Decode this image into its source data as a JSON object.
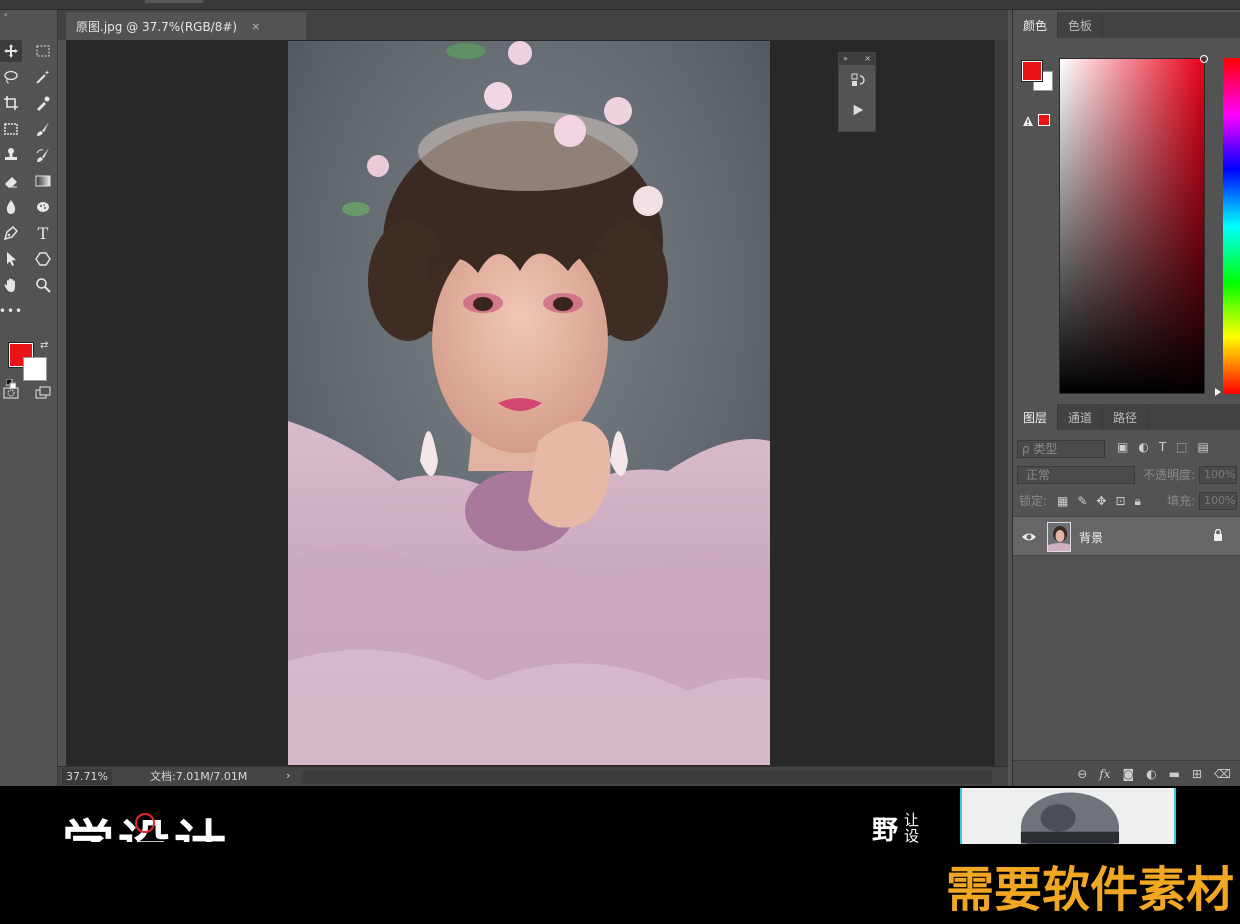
{
  "document": {
    "tab_title": "原图.jpg @ 37.7%(RGB/8#)",
    "tab_close": "×"
  },
  "status": {
    "zoom": "37.71%",
    "doc_info": "文档:7.01M/7.01M",
    "arrow": "›"
  },
  "colors": {
    "foreground": "#e8141a",
    "background": "#ffffff"
  },
  "color_panel": {
    "tabs": [
      "颜色",
      "色板"
    ]
  },
  "layers_panel": {
    "tabs": [
      "图层",
      "通道",
      "路径"
    ],
    "kind_filter": "ρ 类型",
    "blend_mode": "正常",
    "opacity_label": "不透明度:",
    "opacity_value": "100%",
    "lock_label": "锁定:",
    "fill_label": "填充:",
    "fill_value": "100%",
    "layers": [
      {
        "name": "背景",
        "visible": true,
        "locked": true
      }
    ]
  },
  "overlay": {
    "headline": "学设计",
    "side_big": "野",
    "side_small": "让设",
    "banner": "需要软件素材"
  }
}
